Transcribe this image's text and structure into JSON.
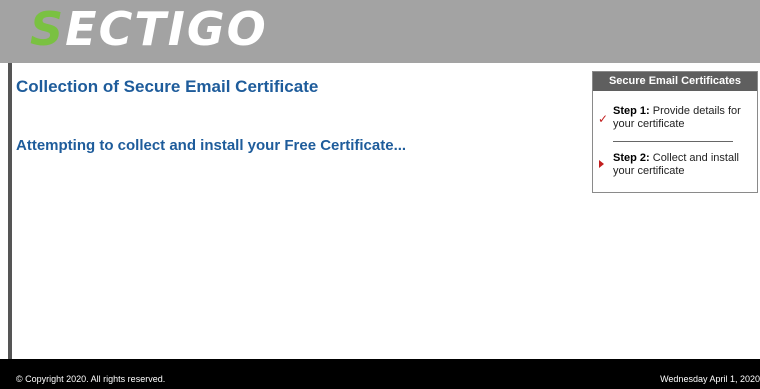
{
  "header": {
    "logo_first": "S",
    "logo_rest": "ECTIGO"
  },
  "main": {
    "title": "Collection of Secure Email Certificate",
    "status": "Attempting to collect and install your Free Certificate..."
  },
  "panel": {
    "heading": "Secure Email Certificates",
    "steps": [
      {
        "label": "Step 1:",
        "text": "Provide details for your certificate",
        "state": "done",
        "marker": "✓"
      },
      {
        "label": "Step 2:",
        "text": "Collect and install your certificate",
        "state": "current",
        "marker": "arrow"
      }
    ]
  },
  "footer": {
    "copyright": "© Copyright 2020. All rights reserved.",
    "date": "Wednesday April 1, 2020"
  },
  "colors": {
    "header_bg": "#a3a3a3",
    "logo_accent": "#7ac142",
    "title_blue": "#1e5c9b",
    "panel_head_bg": "#5f5f5f",
    "marker_red": "#c21f1f",
    "footer_bg": "#000000"
  }
}
